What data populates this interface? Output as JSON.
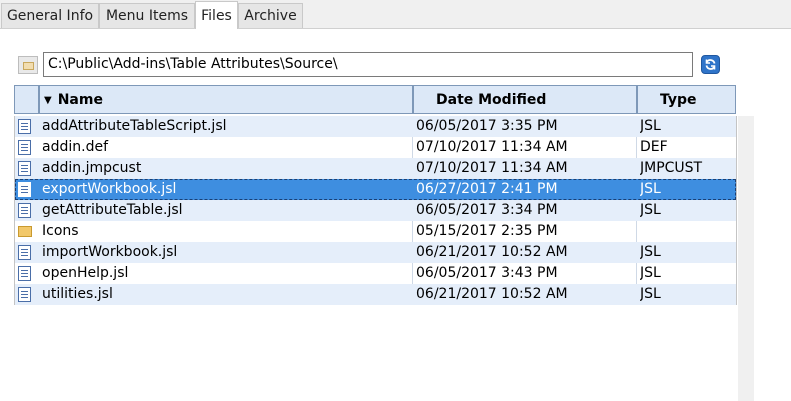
{
  "tabs": [
    {
      "label": "General Info",
      "active": false
    },
    {
      "label": "Menu Items",
      "active": false
    },
    {
      "label": "Files",
      "active": true
    },
    {
      "label": "Archive",
      "active": false
    }
  ],
  "path": {
    "value": "C:\\Public\\Add-ins\\Table Attributes\\Source\\"
  },
  "columns": {
    "name": "Name",
    "date": "Date Modified",
    "type": "Type",
    "sort_indicator": "▼"
  },
  "files": [
    {
      "icon": "jsl-file-icon",
      "name": "addAttributeTableScript.jsl",
      "date": "06/05/2017 3:35 PM",
      "type": "JSL"
    },
    {
      "icon": "document-icon",
      "name": "addin.def",
      "date": "07/10/2017 11:34 AM",
      "type": "DEF"
    },
    {
      "icon": "document-icon",
      "name": "addin.jmpcust",
      "date": "07/10/2017 11:34 AM",
      "type": "JMPCUST"
    },
    {
      "icon": "jsl-file-icon",
      "name": "exportWorkbook.jsl",
      "date": "06/27/2017 2:41 PM",
      "type": "JSL",
      "selected": true
    },
    {
      "icon": "jsl-file-icon",
      "name": "getAttributeTable.jsl",
      "date": "06/05/2017 3:34 PM",
      "type": "JSL"
    },
    {
      "icon": "folder-icon",
      "name": "Icons",
      "date": "05/15/2017 2:35 PM",
      "type": ""
    },
    {
      "icon": "jsl-file-icon",
      "name": "importWorkbook.jsl",
      "date": "06/21/2017 10:52 AM",
      "type": "JSL"
    },
    {
      "icon": "jsl-file-icon",
      "name": "openHelp.jsl",
      "date": "06/05/2017 3:43 PM",
      "type": "JSL"
    },
    {
      "icon": "jsl-file-icon",
      "name": "utilities.jsl",
      "date": "06/21/2017 10:52 AM",
      "type": "JSL"
    }
  ],
  "colors": {
    "selection": "#3e8ee0",
    "row_alt": "#e5eefa",
    "header_bg": "#dce8f7"
  }
}
